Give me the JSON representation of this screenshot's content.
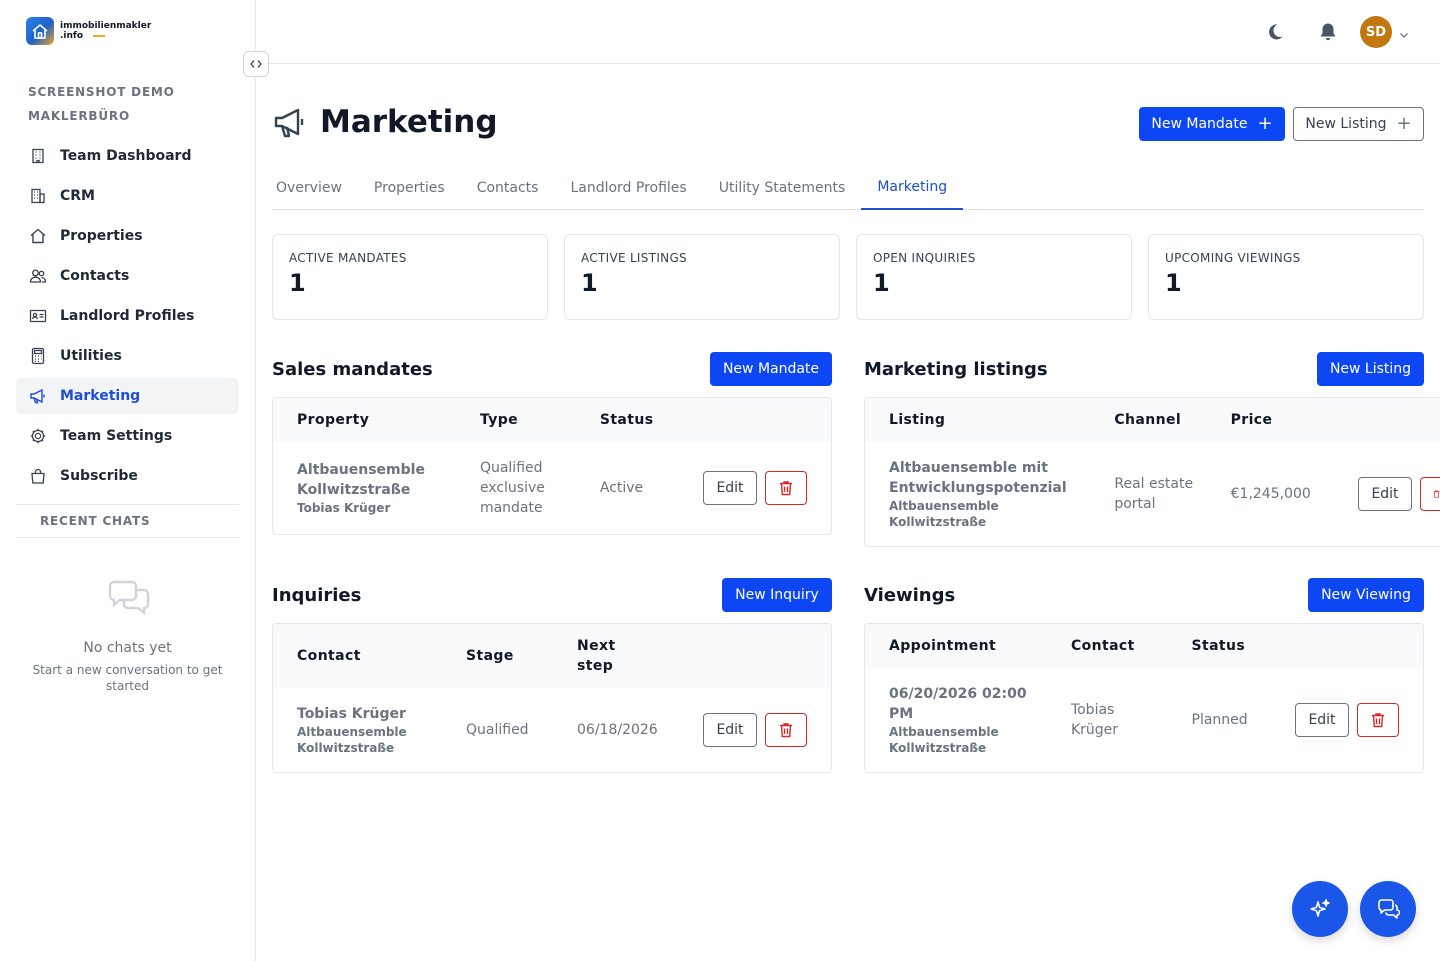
{
  "app": {
    "logo_line1": "immobilienmakler",
    "logo_line2": ".info"
  },
  "sidebar": {
    "org_line1": "SCREENSHOT DEMO",
    "org_line2": "MAKLERBÜRO",
    "items": [
      {
        "label": "Team Dashboard",
        "icon": "building-icon"
      },
      {
        "label": "CRM",
        "icon": "buildings-icon"
      },
      {
        "label": "Properties",
        "icon": "house-icon"
      },
      {
        "label": "Contacts",
        "icon": "people-icon"
      },
      {
        "label": "Landlord Profiles",
        "icon": "id-card-icon"
      },
      {
        "label": "Utilities",
        "icon": "calculator-icon"
      },
      {
        "label": "Marketing",
        "icon": "megaphone-icon"
      },
      {
        "label": "Team Settings",
        "icon": "gear-icon"
      },
      {
        "label": "Subscribe",
        "icon": "shopping-bag-icon"
      }
    ],
    "active_item": "Marketing",
    "recent_chats_label": "RECENT CHATS",
    "no_chats_title": "No chats yet",
    "no_chats_sub": "Start a new conversation to get started"
  },
  "topbar": {
    "avatar_initials": "SD"
  },
  "page": {
    "title": "Marketing",
    "new_mandate": "New Mandate",
    "new_listing": "New Listing"
  },
  "tabs": [
    "Overview",
    "Properties",
    "Contacts",
    "Landlord Profiles",
    "Utility Statements",
    "Marketing"
  ],
  "active_tab": "Marketing",
  "stats": [
    {
      "label": "ACTIVE MANDATES",
      "value": "1"
    },
    {
      "label": "ACTIVE LISTINGS",
      "value": "1"
    },
    {
      "label": "OPEN INQUIRIES",
      "value": "1"
    },
    {
      "label": "UPCOMING VIEWINGS",
      "value": "1"
    }
  ],
  "mandates": {
    "title": "Sales mandates",
    "button": "New Mandate",
    "columns": [
      "Property",
      "Type",
      "Status"
    ],
    "row": {
      "property": "Altbauensemble Kollwitzstraße",
      "contact": "Tobias Krüger",
      "type": "Qualified exclusive mandate",
      "status": "Active",
      "edit": "Edit"
    }
  },
  "listings": {
    "title": "Marketing listings",
    "button": "New Listing",
    "columns": [
      "Listing",
      "Channel",
      "Price"
    ],
    "row": {
      "listing": "Altbauensemble mit Entwicklungspotenzial",
      "property": "Altbauensemble Kollwitzstraße",
      "channel": "Real estate portal",
      "price": "€1,245,000",
      "edit": "Edit"
    }
  },
  "inquiries": {
    "title": "Inquiries",
    "button": "New Inquiry",
    "columns": [
      "Contact",
      "Stage",
      "Next step"
    ],
    "row": {
      "contact": "Tobias Krüger",
      "property": "Altbauensemble Kollwitzstraße",
      "stage": "Qualified",
      "next_step": "06/18/2026",
      "edit": "Edit"
    }
  },
  "viewings": {
    "title": "Viewings",
    "button": "New Viewing",
    "columns": [
      "Appointment",
      "Contact",
      "Status"
    ],
    "row": {
      "appointment": "06/20/2026 02:00 PM",
      "property": "Altbauensemble Kollwitzstraße",
      "contact": "Tobias Krüger",
      "status": "Planned",
      "edit": "Edit"
    }
  },
  "colors": {
    "primary": "#0d47f5",
    "active_nav": "#1d4ed8",
    "danger": "#dc2626",
    "avatar": "#c2780f"
  }
}
